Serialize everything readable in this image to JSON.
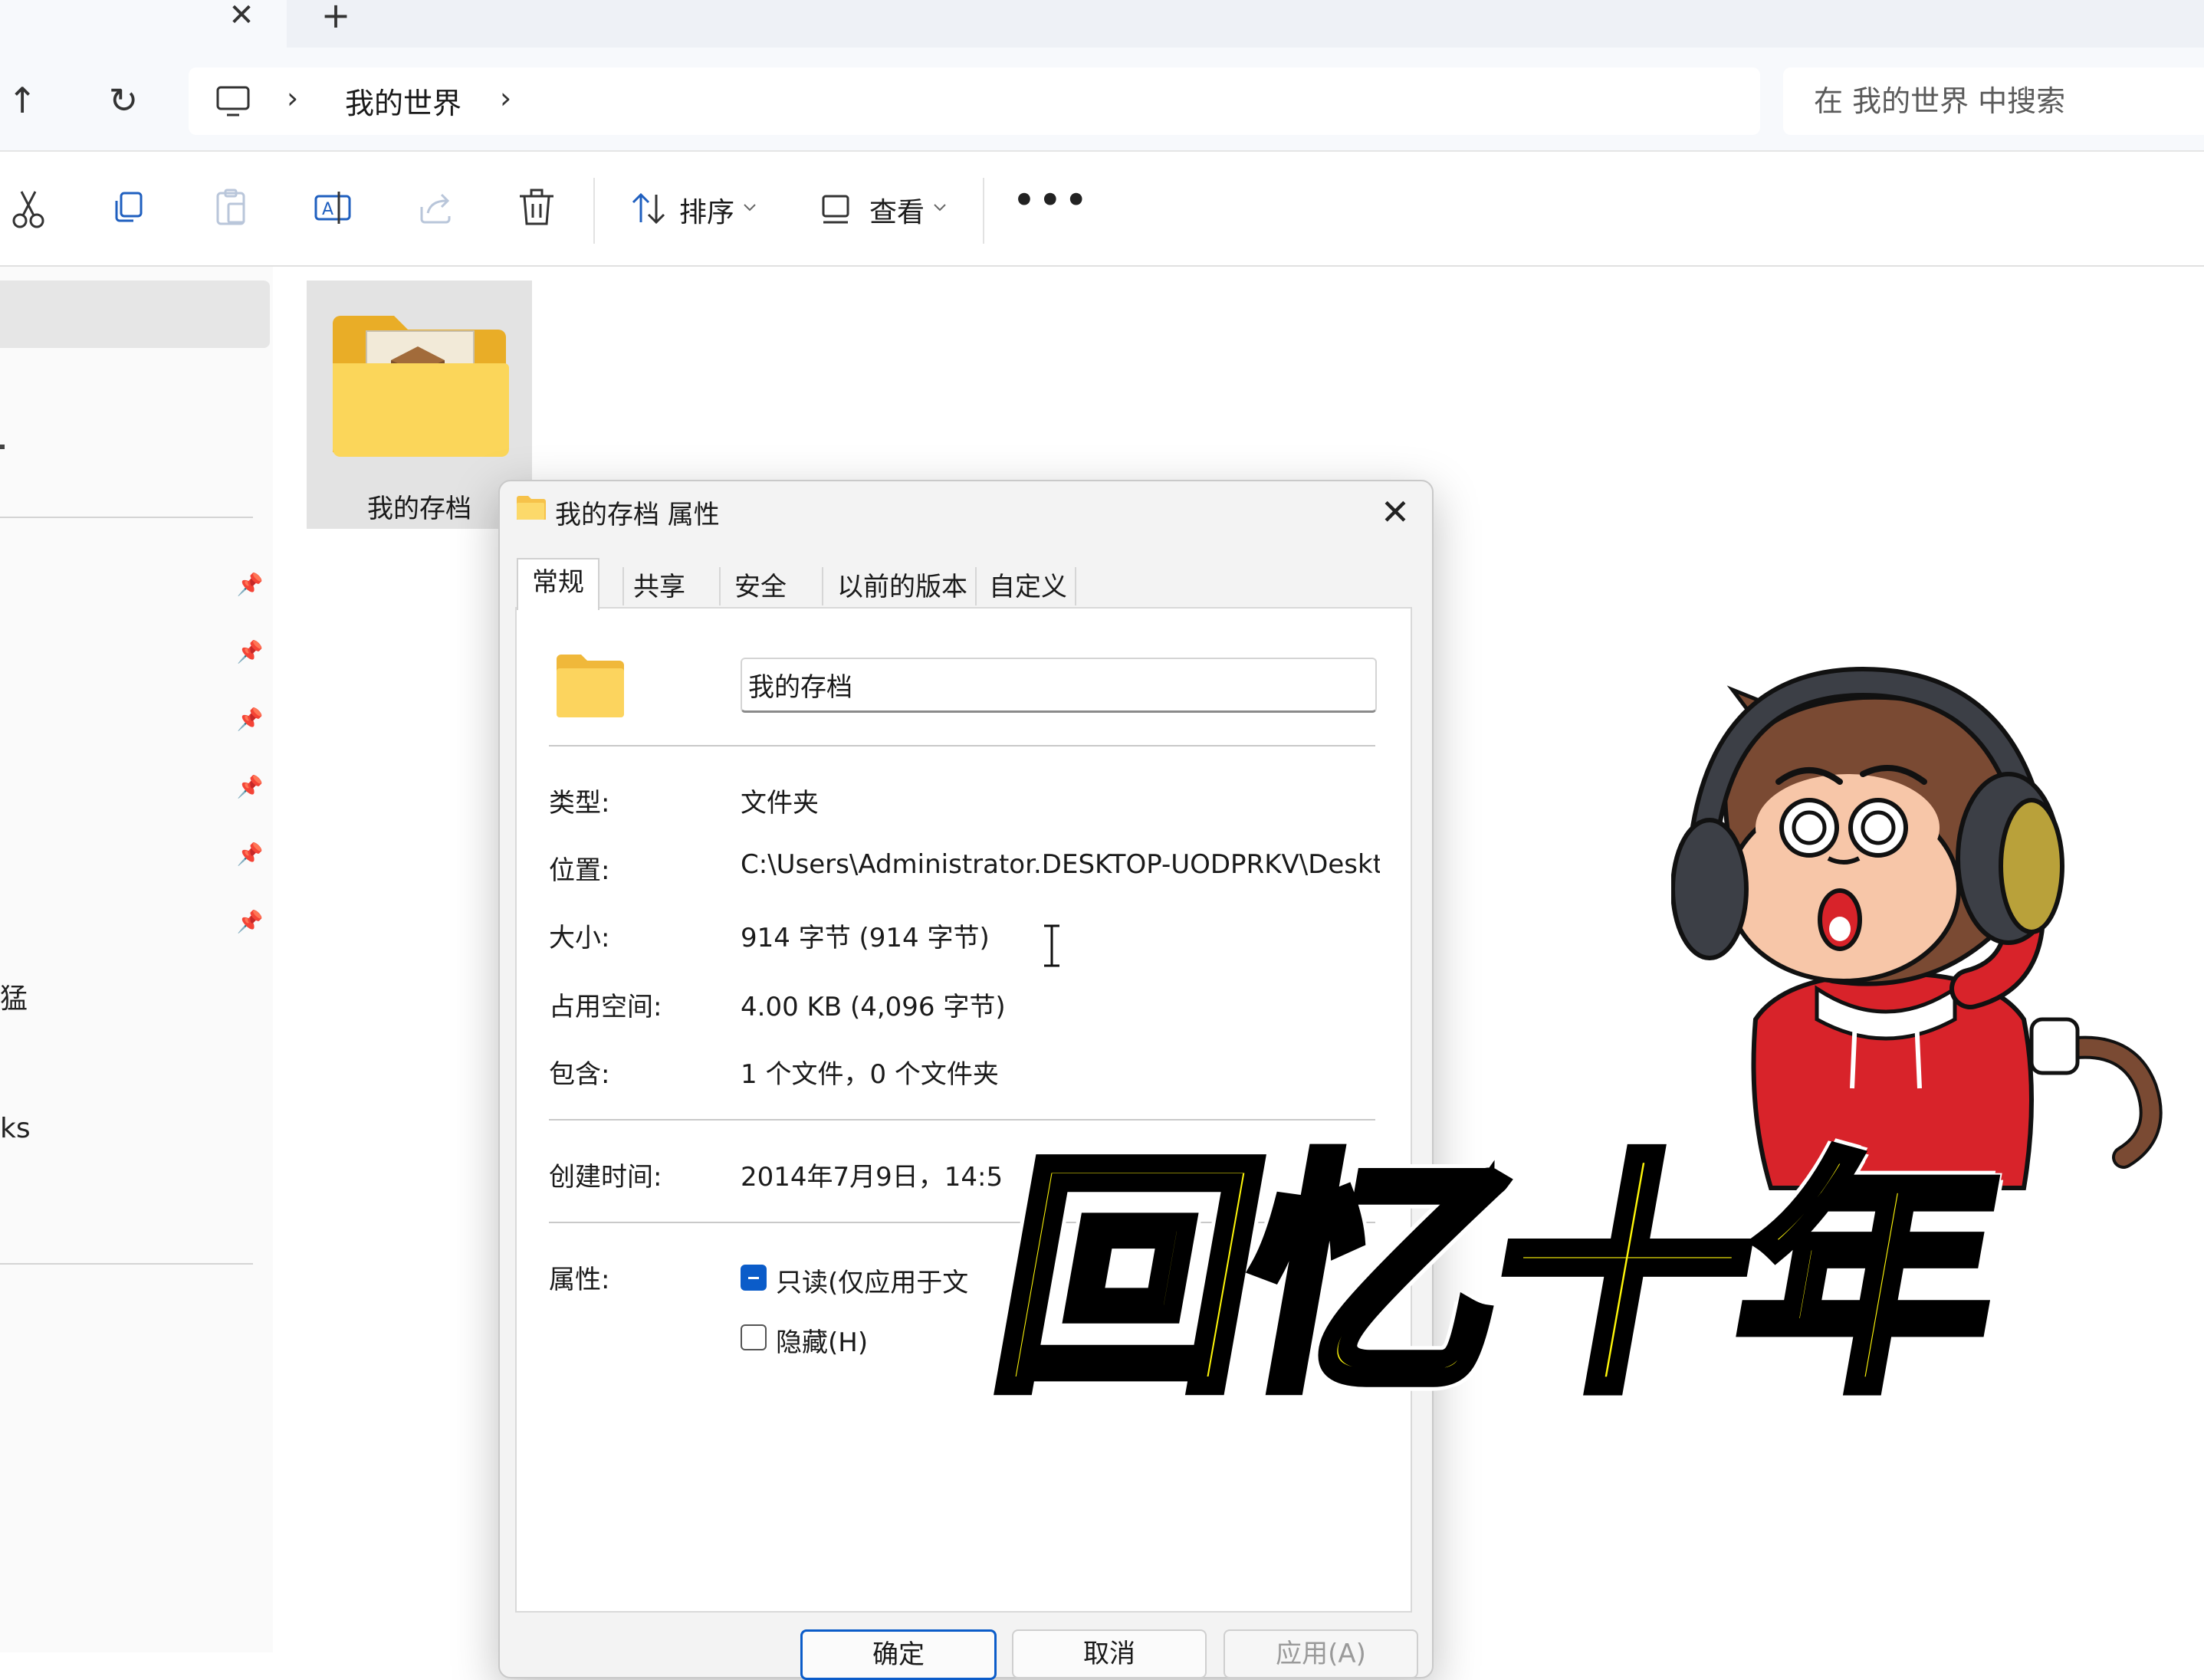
{
  "tabs": {
    "close_glyph": "✕",
    "new_tab_glyph": "+"
  },
  "navigation": {
    "up_glyph": "↑",
    "refresh_glyph": "↻",
    "breadcrumb": [
      "我的世界"
    ],
    "separator": "›",
    "search_placeholder": "在 我的世界 中搜索"
  },
  "commandbar": {
    "icons": [
      "cut-icon",
      "copy-icon",
      "paste-icon",
      "rename-icon",
      "share-icon",
      "delete-icon"
    ],
    "sort_label": "排序",
    "view_label": "查看",
    "more_glyph": "•••"
  },
  "nav_pane": {
    "partial_labels": [
      "猛",
      "ks"
    ]
  },
  "folder_item": {
    "label": "我的存档"
  },
  "dialog": {
    "title": "我的存档 属性",
    "tabs": [
      "常规",
      "共享",
      "安全",
      "以前的版本",
      "自定义"
    ],
    "name_value": "我的存档",
    "properties": [
      {
        "label": "类型:",
        "value": "文件夹"
      },
      {
        "label": "位置:",
        "value": "C:\\Users\\Administrator.DESKTOP-UODPRKV\\Desktop"
      },
      {
        "label": "大小:",
        "value": "914 字节 (914 字节)"
      },
      {
        "label": "占用空间:",
        "value": "4.00 KB (4,096 字节)"
      },
      {
        "label": "包含:",
        "value": "1 个文件，0 个文件夹"
      }
    ],
    "created": {
      "label": "创建时间:",
      "value": "2014年7月9日，14:5"
    },
    "attributes": {
      "label": "属性:",
      "readonly_label": "只读(仅应用于文",
      "hidden_label": "隐藏(H)"
    },
    "buttons": {
      "ok": "确定",
      "cancel": "取消",
      "apply": "应用(A)"
    }
  },
  "overlay": {
    "caption": "回忆十年"
  },
  "colors": {
    "accent": "#0b5cc9",
    "folder_yellow": "#f9cf4a",
    "caption_yellow": "#fff70a",
    "hoodie_red": "#d8232a"
  }
}
